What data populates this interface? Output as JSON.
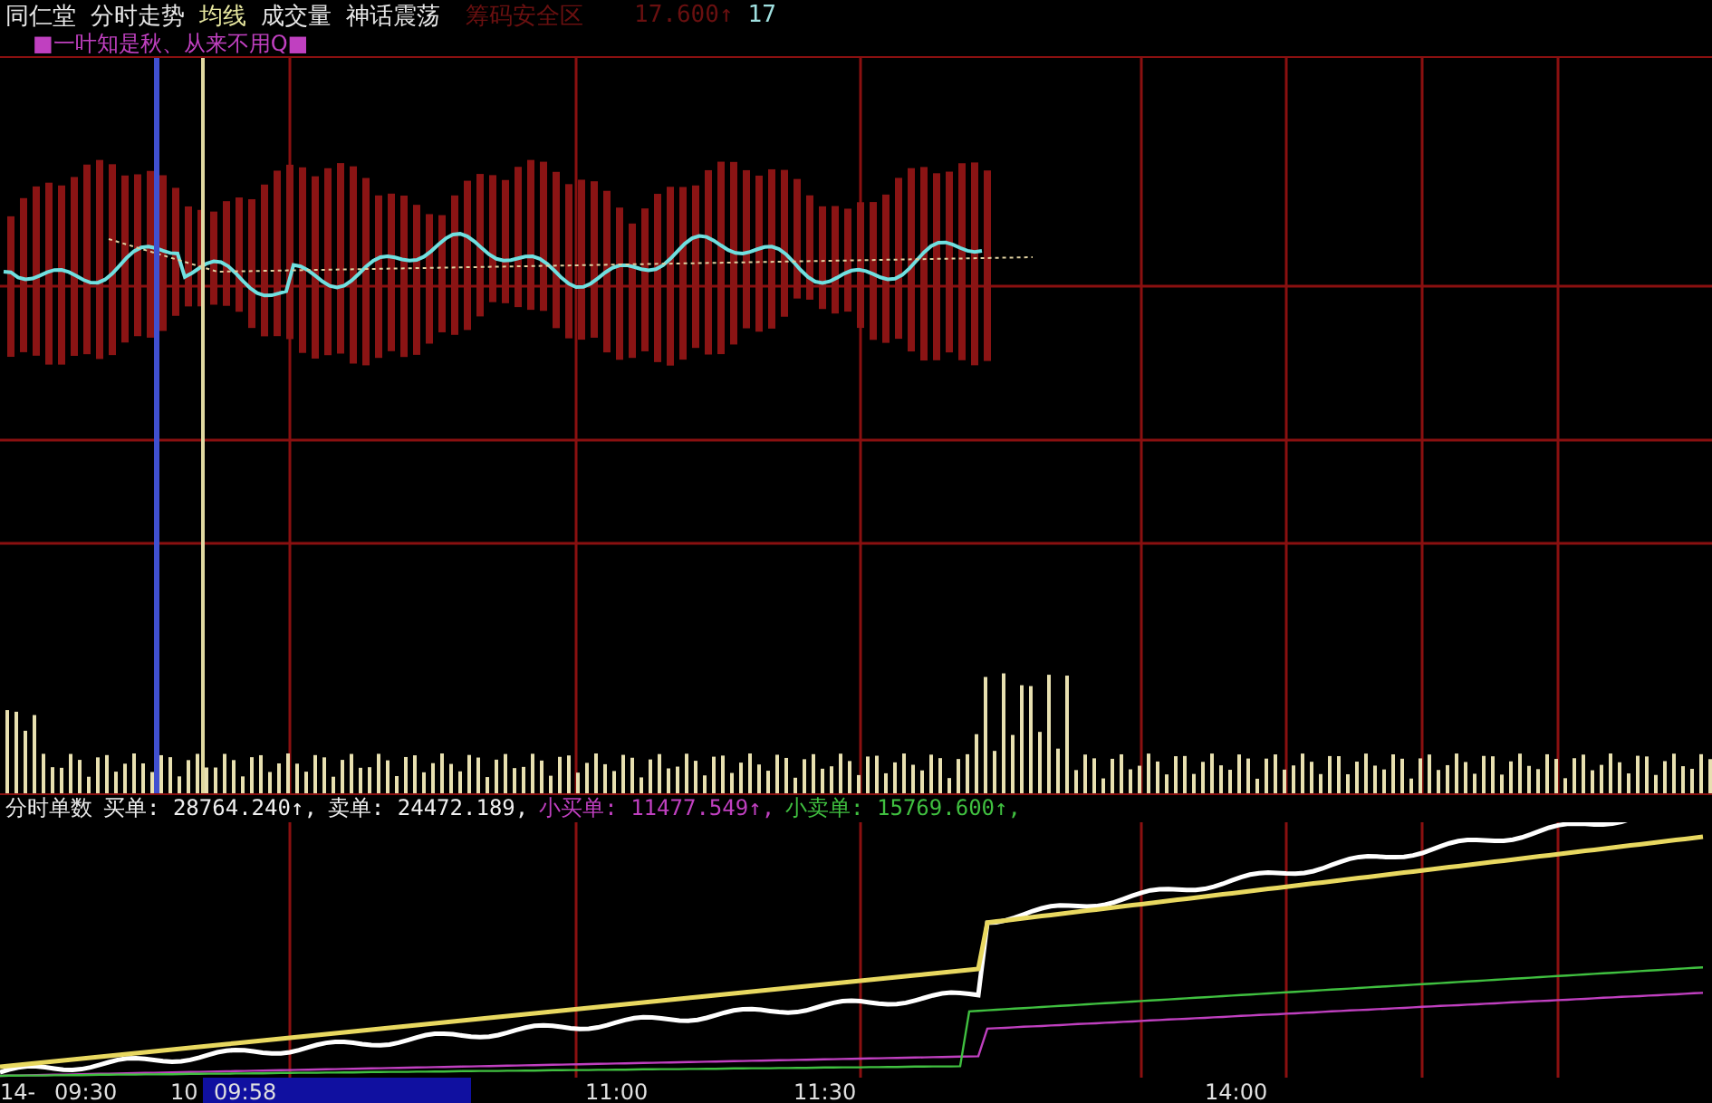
{
  "header": {
    "stock_name": "同仁堂",
    "indicators": [
      "分时走势",
      "均线",
      "成交量",
      "神话震荡"
    ],
    "zone_label": "筹码安全区",
    "price": "17.600↑",
    "value": "17"
  },
  "formula_note": "■一叶知是秋、从来不用Q■",
  "order_panel": {
    "title": "分时单数",
    "stats": [
      {
        "label": "买单:",
        "value": "28764.240↑,",
        "color": "#f0f0f0"
      },
      {
        "label": "卖单:",
        "value": "24472.189,",
        "color": "#f0f0f0"
      },
      {
        "label": "小买单:",
        "value": "11477.549↑,",
        "color": "#c040c0"
      },
      {
        "label": "小卖单:",
        "value": "15769.600↑,",
        "color": "#40c040"
      }
    ]
  },
  "time_axis": {
    "labels": [
      "14-",
      "09:30",
      "10",
      "11:00",
      "11:30",
      "14:00"
    ],
    "cursor_time": "09:58"
  }
}
